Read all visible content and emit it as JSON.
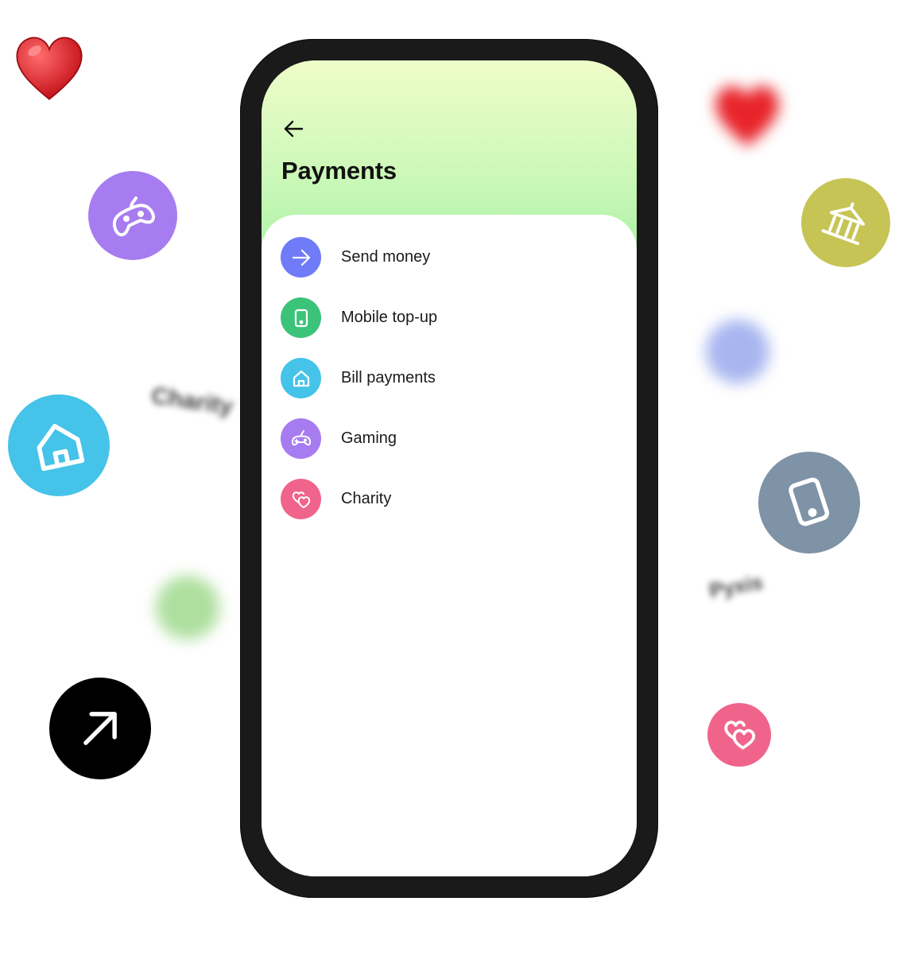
{
  "screen": {
    "title": "Payments",
    "back_icon": "arrow-left-icon"
  },
  "menu": {
    "items": [
      {
        "label": "Send money",
        "icon": "arrow-right-icon",
        "color": "#6f7bf7"
      },
      {
        "label": "Mobile top-up",
        "icon": "phone-icon",
        "color": "#3cc37a"
      },
      {
        "label": "Bill payments",
        "icon": "house-icon",
        "color": "#45c3e8"
      },
      {
        "label": "Gaming",
        "icon": "gamepad-icon",
        "color": "#a77cf0"
      },
      {
        "label": "Charity",
        "icon": "hearts-icon",
        "color": "#f0648c"
      }
    ]
  },
  "decorations": {
    "colors": {
      "heart": "#e8242a",
      "gamepad": "#a77cf0",
      "bank": "#c6c454",
      "house": "#45c3e8",
      "tablet": "#7f93a6",
      "arrow": "#000000",
      "hearts": "#f0648c",
      "blur_blue": "#a8b6f0",
      "blur_green": "#aedf9e"
    }
  }
}
